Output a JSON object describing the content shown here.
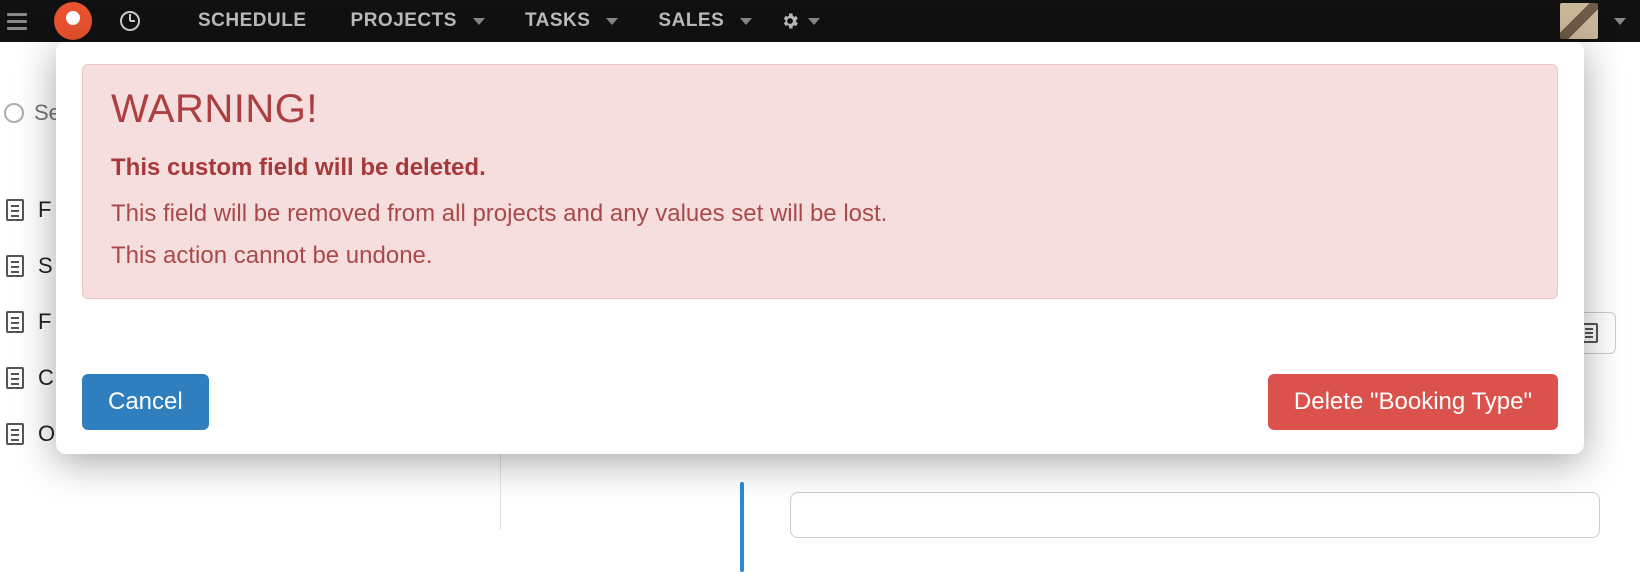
{
  "nav": {
    "items": [
      {
        "label": "SCHEDULE",
        "caret": false
      },
      {
        "label": "PROJECTS",
        "caret": true
      },
      {
        "label": "TASKS",
        "caret": true
      },
      {
        "label": "SALES",
        "caret": true
      }
    ]
  },
  "search": {
    "placeholder": "Se"
  },
  "sidebar": {
    "items": [
      {
        "label": "F"
      },
      {
        "label": "S"
      },
      {
        "label": "F"
      },
      {
        "label": "C"
      },
      {
        "label": "Organizations"
      }
    ]
  },
  "modal": {
    "title": "WARNING!",
    "strong": "This custom field will be deleted.",
    "line1": "This field will be removed from all projects and any values set will be lost.",
    "line2": "This action cannot be undone.",
    "cancel_label": "Cancel",
    "delete_label": "Delete \"Booking Type\""
  }
}
